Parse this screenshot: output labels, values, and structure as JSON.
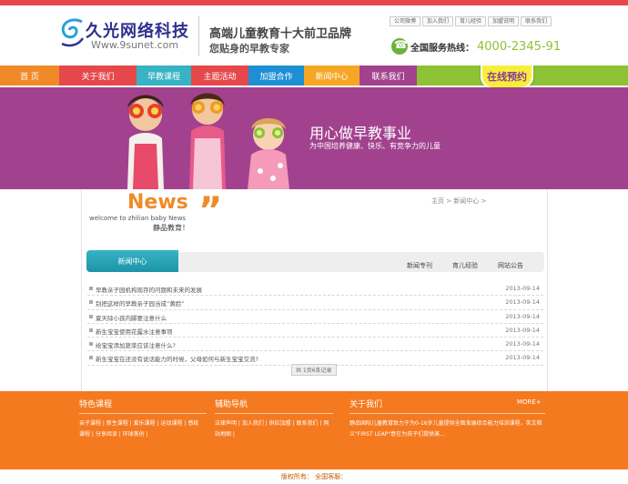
{
  "header": {
    "logo_text": "久光网络科技",
    "logo_url": "Www.9sunet.com",
    "slogan_main": "高端儿童教育十大前卫品牌",
    "slogan_sub": "您贴身的早教专家",
    "top_links": [
      "公司微博",
      "加入我们",
      "育儿经验",
      "加盟说明",
      "联系我们"
    ],
    "hotline_label": "全国服务热线：",
    "hotline_number": "4000-2345-91"
  },
  "nav": {
    "items": [
      {
        "label": "首 页",
        "color": "#f08a28"
      },
      {
        "label": "关于我们",
        "color": "#e5484a"
      },
      {
        "label": "早教课程",
        "color": "#36b3c4"
      },
      {
        "label": "主题活动",
        "color": "#e5484a"
      },
      {
        "label": "加盟合作",
        "color": "#1f8fd4"
      },
      {
        "label": "新闻中心",
        "color": "#f5a623"
      },
      {
        "label": "联系我们",
        "color": "#a2428e"
      }
    ],
    "booking_label": "在线预约"
  },
  "banner": {
    "title": "用心做早教事业",
    "subtitle": "为中国培养健康、快乐、有竞争力的儿童"
  },
  "content": {
    "news_big": "News",
    "welcome": "welcome to zhilian baby News",
    "tagline": "静品教育！",
    "breadcrumb": "主页 >  新闻中心  >",
    "tab_active": "新闻中心",
    "subtabs": [
      "新闻专刊",
      "育儿经验",
      "网站公告"
    ],
    "news": [
      {
        "title": "早教亲子园机构现存的问题和未来的发展",
        "date": "2013-09-14"
      },
      {
        "title": "别把这样的早教亲子园当成“黄脸”",
        "date": "2013-09-14"
      },
      {
        "title": "夏天除小孩内脚要注意什么",
        "date": "2013-09-14"
      },
      {
        "title": "新生宝宝使用花露水注意事项",
        "date": "2013-09-14"
      },
      {
        "title": "给宝宝添加蔬菜应该注意什么?",
        "date": "2013-09-14"
      },
      {
        "title": "新生宝宝在还没有说话能力的时候，父母如何与新生宝宝交流?",
        "date": "2013-09-14"
      }
    ],
    "pager": "共 1页6条记录"
  },
  "footer": {
    "col1_title": "特色课程",
    "col1_links": "亲子课程 | 新生课程 | 爱乐课程 | 运动课程 | 感统课程 | 分享阅读 | 环球美创 |",
    "col2_title": "辅助导航",
    "col2_links": "法律声明 | 加入我们 | 供应加盟 | 联系我们 | 网站地图 |",
    "col3_title": "关于我们",
    "more": "MORE+",
    "about_text": "静品国际儿童教育致力于为0-16岁儿童提供全面发展综合能力培训课程，英文释义\"FIRST LEAP\"意在为孩子们提供蒸...",
    "copyright": "版权所有： 全国客服："
  },
  "colors": {
    "accent_orange": "#f5791f",
    "banner_purple": "#a2428e",
    "top_red": "#e5484a"
  }
}
